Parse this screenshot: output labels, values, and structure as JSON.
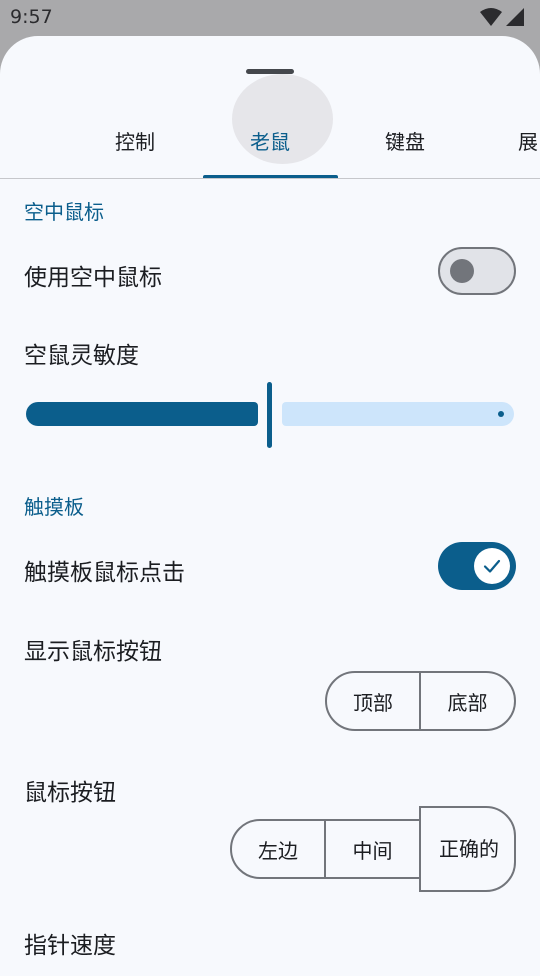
{
  "status_bar": {
    "time": "9:57",
    "wifi_icon": "wifi-icon",
    "signal_icon": "cell-signal-icon"
  },
  "tabs": [
    {
      "label": "控制",
      "active": false
    },
    {
      "label": "老鼠",
      "active": true
    },
    {
      "label": "键盘",
      "active": false
    },
    {
      "label": "展",
      "active": false
    }
  ],
  "air_mouse": {
    "section_title": "空中鼠标",
    "enable_label": "使用空中鼠标",
    "enable_on": false,
    "sensitivity_label": "空鼠灵敏度",
    "sensitivity_fraction": 0.5
  },
  "touchpad": {
    "section_title": "触摸板",
    "click_label": "触摸板鼠标点击",
    "click_on": true,
    "show_buttons_label": "显示鼠标按钮",
    "show_buttons_options": [
      "顶部",
      "底部"
    ],
    "buttons_label": "鼠标按钮",
    "buttons_options": [
      "左边",
      "中间",
      "正确的"
    ],
    "pointer_speed_label": "指针速度"
  },
  "colors": {
    "accent": "#0b5e8c",
    "slider_track": "#cde5fb",
    "surface": "#f7f9fd",
    "scrim": "#a9a9ab"
  }
}
